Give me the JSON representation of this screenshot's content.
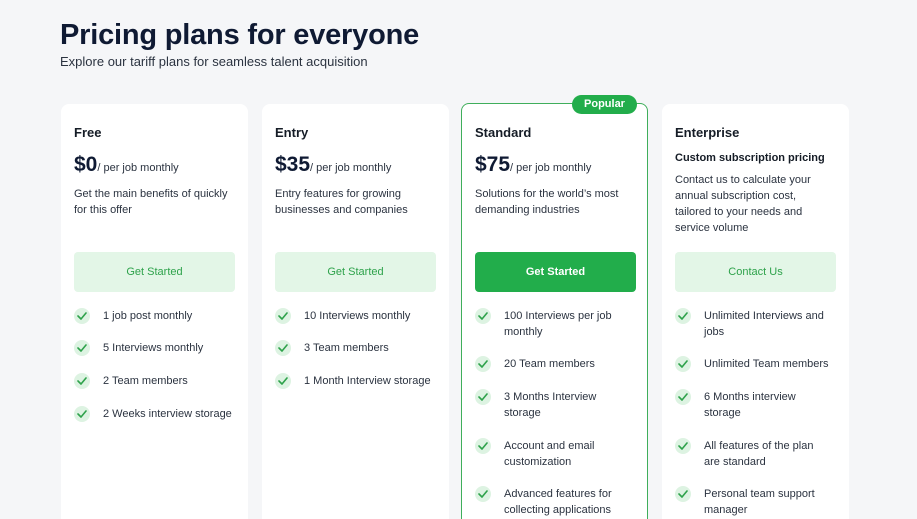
{
  "hero": {
    "title": "Pricing plans for everyone",
    "subtitle": "Explore our tariff plans for seamless talent acquisition"
  },
  "colors": {
    "accent": "#22ad4b",
    "accent_light": "#e3f6e7",
    "heading": "#0f1a33"
  },
  "plans": [
    {
      "name": "Free",
      "price": "$0",
      "per": "/ per job monthly",
      "desc": "Get the main benefits of quickly for this offer",
      "cta": "Get Started",
      "features": [
        "1 job post monthly",
        "5 Interviews monthly",
        "2 Team members",
        "2 Weeks interview storage"
      ]
    },
    {
      "name": "Entry",
      "price": "$35",
      "per": "/ per job monthly",
      "desc": "Entry features for growing businesses and companies",
      "cta": "Get Started",
      "features": [
        "10 Interviews monthly",
        "3 Team members",
        "1 Month Interview storage"
      ]
    },
    {
      "name": "Standard",
      "badge": "Popular",
      "price": "$75",
      "per": "/ per job monthly",
      "desc": "Solutions for the world’s most demanding industries",
      "cta": "Get Started",
      "features": [
        "100 Interviews per job monthly",
        "20 Team members",
        "3 Months Interview storage",
        "Account and email customization",
        "Advanced features for collecting applications"
      ]
    },
    {
      "name": "Enterprise",
      "custom_title": "Custom subscription pricing",
      "desc": "Contact us to calculate your annual subscription cost, tailored to your needs and service volume",
      "cta": "Contact Us",
      "features": [
        "Unlimited Interviews and jobs",
        "Unlimited Team members",
        "6 Months interview storage",
        "All features of the plan are standard",
        "Personal team support manager"
      ]
    }
  ]
}
